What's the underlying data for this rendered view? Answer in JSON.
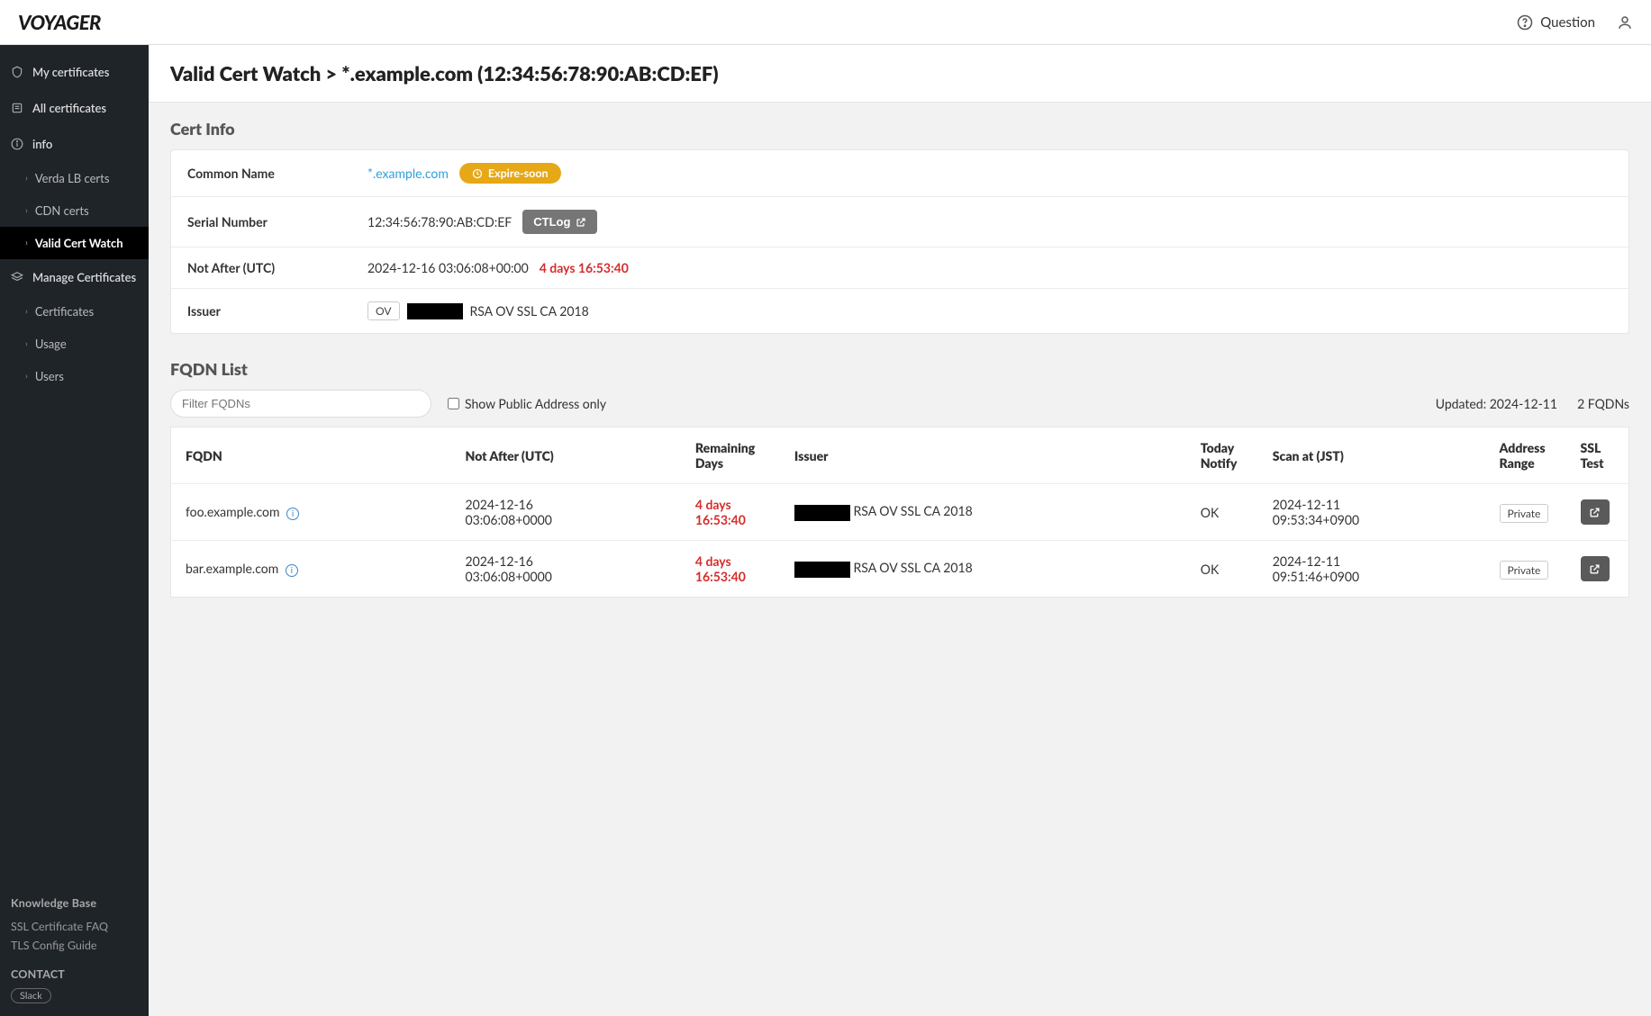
{
  "header": {
    "brand": "VOYAGER",
    "question": "Question"
  },
  "sidebar": {
    "items": [
      {
        "label": "My certificates"
      },
      {
        "label": "All certificates"
      },
      {
        "label": "info",
        "children": [
          {
            "label": "Verda LB certs"
          },
          {
            "label": "CDN certs"
          },
          {
            "label": "Valid Cert Watch",
            "active": true
          }
        ]
      },
      {
        "label": "Manage Certificates",
        "children": [
          {
            "label": "Certificates"
          },
          {
            "label": "Usage"
          },
          {
            "label": "Users"
          }
        ]
      }
    ],
    "kb_heading": "Knowledge Base",
    "kb_links": [
      "SSL Certificate FAQ",
      "TLS Config Guide"
    ],
    "contact_heading": "CONTACT",
    "contact_badge": "Slack"
  },
  "page": {
    "title": "Valid Cert Watch > *.example.com (12:34:56:78:90:AB:CD:EF)"
  },
  "cert_info": {
    "title": "Cert Info",
    "rows": {
      "common_name_label": "Common Name",
      "common_name_value": "*.example.com",
      "expire_badge": "Expire-soon",
      "serial_label": "Serial Number",
      "serial_value": "12:34:56:78:90:AB:CD:EF",
      "ctlog_btn": "CTLog",
      "not_after_label": "Not After (UTC)",
      "not_after_value": "2024-12-16 03:06:08+00:00",
      "not_after_remaining": "4 days 16:53:40",
      "issuer_label": "Issuer",
      "issuer_type": "OV",
      "issuer_name": "RSA OV SSL CA 2018"
    }
  },
  "fqdn": {
    "title": "FQDN List",
    "filter_placeholder": "Filter FQDNs",
    "checkbox_label": "Show Public Address only",
    "updated_text": "Updated: 2024-12-11",
    "count_text": "2 FQDNs",
    "columns": {
      "fqdn": "FQDN",
      "not_after": "Not After (UTC)",
      "remaining": "Remaining Days",
      "issuer": "Issuer",
      "today_notify": "Today Notify",
      "scan_at": "Scan at (JST)",
      "addr_range": "Address Range",
      "ssl_test": "SSL Test"
    },
    "rows": [
      {
        "fqdn": "foo.example.com",
        "not_after_l1": "2024-12-16",
        "not_after_l2": "03:06:08+0000",
        "remaining_l1": "4 days",
        "remaining_l2": "16:53:40",
        "issuer_name": "RSA OV SSL CA 2018",
        "notify": "OK",
        "scan_l1": "2024-12-11",
        "scan_l2": "09:53:34+0900",
        "addr": "Private"
      },
      {
        "fqdn": "bar.example.com",
        "not_after_l1": "2024-12-16",
        "not_after_l2": "03:06:08+0000",
        "remaining_l1": "4 days",
        "remaining_l2": "16:53:40",
        "issuer_name": "RSA OV SSL CA 2018",
        "notify": "OK",
        "scan_l1": "2024-12-11",
        "scan_l2": "09:51:46+0900",
        "addr": "Private"
      }
    ]
  }
}
